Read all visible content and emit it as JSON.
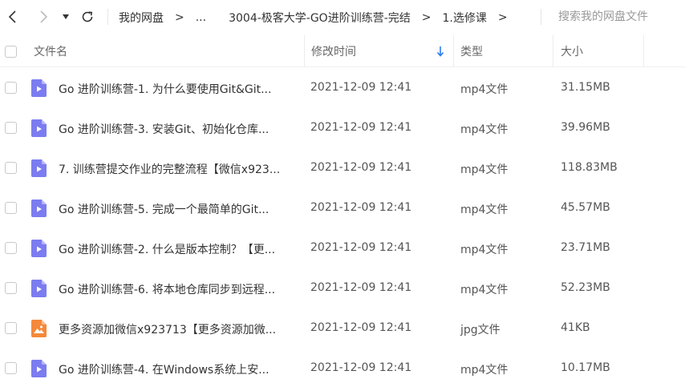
{
  "nav": {
    "back_icon": "chevron-left-icon",
    "forward_icon": "chevron-right-icon",
    "dropdown_icon": "caret-down-icon",
    "refresh_icon": "refresh-icon"
  },
  "breadcrumb": {
    "root": "我的网盘",
    "ellipsis": "...",
    "folder1": "3004-极客大学-GO进阶训练营-完结",
    "folder2": "1.选修课",
    "separator": ">"
  },
  "search": {
    "placeholder": "搜索我的网盘文件"
  },
  "columns": {
    "name": "文件名",
    "modified": "修改时间",
    "type": "类型",
    "size": "大小"
  },
  "colors": {
    "video_icon": "#7b7cf0",
    "image_icon": "#f5883a",
    "sort_arrow": "#2b7cf0"
  },
  "files": [
    {
      "name": "Go 进阶训练营-1. 为什么要使用Git&Git...",
      "date": "2021-12-09 12:41",
      "type": "mp4文件",
      "size": "31.15MB",
      "icon": "video-file-icon"
    },
    {
      "name": "Go 进阶训练营-3. 安装Git、初始化仓库...",
      "date": "2021-12-09 12:41",
      "type": "mp4文件",
      "size": "39.96MB",
      "icon": "video-file-icon"
    },
    {
      "name": "7. 训练营提交作业的完整流程【微信x923...",
      "date": "2021-12-09 12:41",
      "type": "mp4文件",
      "size": "118.83MB",
      "icon": "video-file-icon"
    },
    {
      "name": "Go 进阶训练营-5. 完成一个最简单的Git...",
      "date": "2021-12-09 12:41",
      "type": "mp4文件",
      "size": "45.57MB",
      "icon": "video-file-icon"
    },
    {
      "name": "Go 进阶训练营-2. 什么是版本控制？【更...",
      "date": "2021-12-09 12:41",
      "type": "mp4文件",
      "size": "23.71MB",
      "icon": "video-file-icon"
    },
    {
      "name": "Go 进阶训练营-6. 将本地仓库同步到远程...",
      "date": "2021-12-09 12:41",
      "type": "mp4文件",
      "size": "52.23MB",
      "icon": "video-file-icon"
    },
    {
      "name": "更多资源加微信x923713【更多资源加微...",
      "date": "2021-12-09 12:41",
      "type": "jpg文件",
      "size": "41KB",
      "icon": "image-file-icon"
    },
    {
      "name": "Go 进阶训练营-4. 在Windows系统上安...",
      "date": "2021-12-09 12:41",
      "type": "mp4文件",
      "size": "10.17MB",
      "icon": "video-file-icon"
    }
  ]
}
